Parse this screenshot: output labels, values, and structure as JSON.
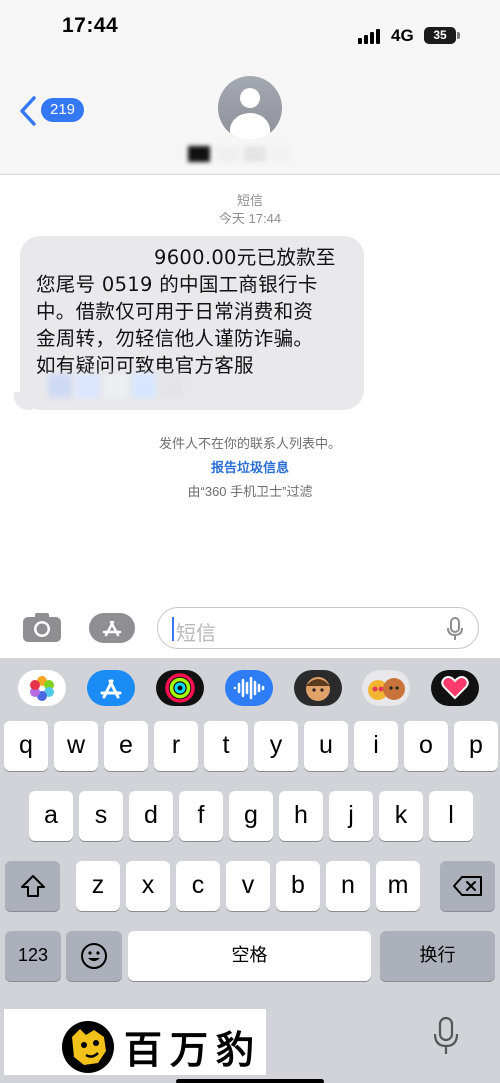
{
  "status_bar": {
    "time": "17:44",
    "network": "4G",
    "battery": "35"
  },
  "header": {
    "back_count": "219"
  },
  "conversation": {
    "service": "短信",
    "timestamp": "今天 17:44"
  },
  "message": {
    "lines": [
      "9600.00元已放款至",
      "您尾号 0519 的中国工商银行卡",
      "中。借款仅可用于日常消费和资",
      "金周转，勿轻信他人谨防诈骗。",
      "如有疑问可致电官方客服"
    ]
  },
  "info": {
    "not_in_contacts": "发件人不在你的联系人列表中。",
    "report_junk": "报告垃圾信息",
    "filtered_by": "由“360 手机卫士”过滤"
  },
  "composer": {
    "placeholder": "短信"
  },
  "app_strip": [
    {
      "icon": "photos-icon",
      "color": "#ffffff"
    },
    {
      "icon": "app-store-icon",
      "color": "#1b8cf5"
    },
    {
      "icon": "activity-icon",
      "color": "#111111"
    },
    {
      "icon": "audio-message-icon",
      "color": "#2f7df6"
    },
    {
      "icon": "memoji-icon",
      "color": "#2b2b2b"
    },
    {
      "icon": "animoji-icon",
      "color": "#e8e8ea"
    },
    {
      "icon": "digital-touch-icon",
      "color": "#111111"
    }
  ],
  "keyboard": {
    "row1": [
      "q",
      "w",
      "e",
      "r",
      "t",
      "y",
      "u",
      "i",
      "o",
      "p"
    ],
    "row2": [
      "a",
      "s",
      "d",
      "f",
      "g",
      "h",
      "j",
      "k",
      "l"
    ],
    "row3": [
      "z",
      "x",
      "c",
      "v",
      "b",
      "n",
      "m"
    ],
    "numbers_key": "123",
    "space_key": "空格",
    "return_key": "换行"
  },
  "watermark": {
    "brand": "百万豹"
  },
  "colors": {
    "accent": "#3478f6",
    "bubble": "#e9e9eb",
    "keyboard_bg": "#d1d3d9"
  }
}
